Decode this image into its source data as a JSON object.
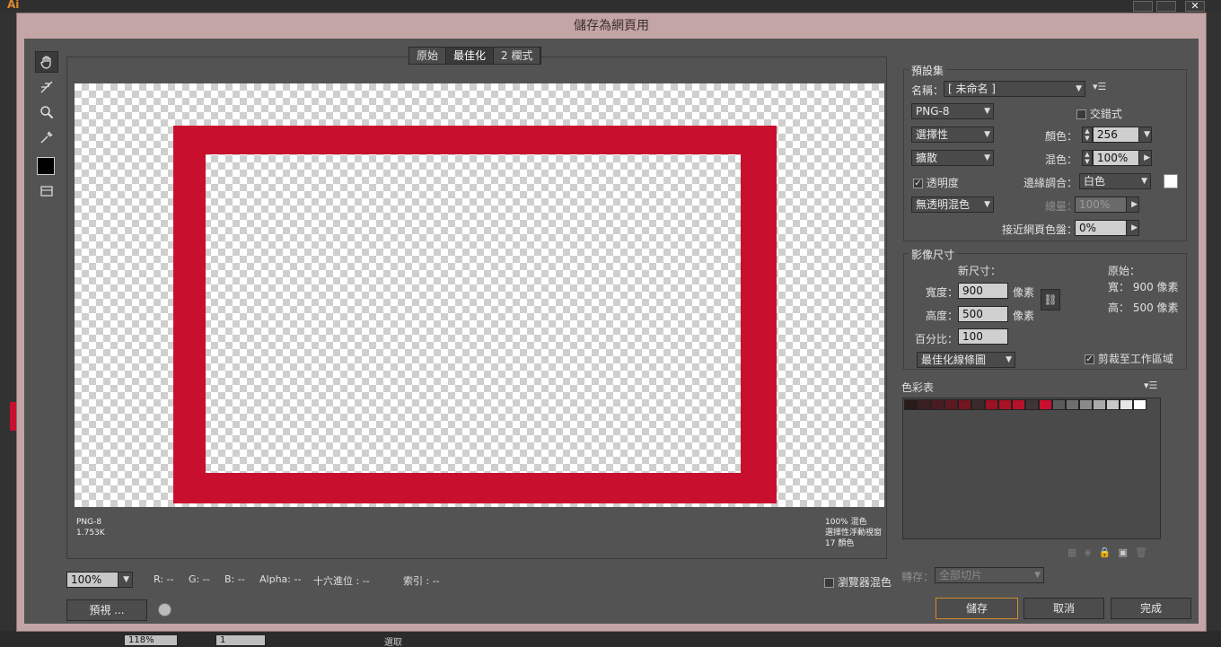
{
  "dialog": {
    "title": "儲存為網頁用"
  },
  "view_tabs": [
    {
      "label": "原始",
      "selected": false
    },
    {
      "label": "最佳化",
      "selected": true
    },
    {
      "label": "2 欄式",
      "selected": false
    }
  ],
  "preview": {
    "format": "PNG-8",
    "size": "1.753K",
    "info_right": [
      "100% 混色",
      "選擇性浮動視窗",
      "17 顏色"
    ]
  },
  "bottom_bar": {
    "zoom": "100%",
    "r": "R: --",
    "g": "G: --",
    "b": "B: --",
    "alpha": "Alpha: --",
    "hex": "十六進位 : --",
    "index": "索引 : --",
    "preview_button": "預視 ...",
    "browser_dither": "瀏覽器混色"
  },
  "preset": {
    "group_title": "預設集",
    "name_label": "名稱：",
    "name_value": "[ 未命名 ]",
    "format": "PNG-8",
    "interlaced_label": "交錯式",
    "reduction": "選擇性",
    "colors_label": "顏色：",
    "colors_value": "256",
    "dither_algo": "擴散",
    "dither_label": "混色：",
    "dither_value": "100%",
    "transparency_label": "透明度",
    "transparency_checked": true,
    "matte_label": "邊緣調合：",
    "matte_value": "白色",
    "trans_dither": "無透明混色",
    "amount_label": "總量：",
    "amount_value": "100%",
    "websnap_label": "接近網頁色盤：",
    "websnap_value": "0%"
  },
  "image_size": {
    "group_title": "影像尺寸",
    "new_size_label": "新尺寸：",
    "original_label": "原始：",
    "width_label": "寬度：",
    "width_value": "900",
    "height_label": "高度：",
    "height_value": "500",
    "unit": "像素",
    "orig_width": "寬： 900 像素",
    "orig_height": "高： 500 像素",
    "percent_label": "百分比：",
    "percent_value": "100",
    "quality": "最佳化線條圖",
    "clip_label": "剪裁至工作區域",
    "clip_checked": true
  },
  "color_table": {
    "title": "色彩表",
    "swatches": [
      "#2a1a1a",
      "#3d1f22",
      "#4a1c22",
      "#5e1820",
      "#741520",
      "#3a2a2a",
      "#9a1224",
      "#a81226",
      "#b5122a",
      "#3e3636",
      "#c8102e",
      "#5a5a5a",
      "#6e6e6e",
      "#8a8a8a",
      "#aaaaaa",
      "#c8c8c8",
      "#e6e6e6",
      "#ffffff"
    ]
  },
  "export": {
    "label": "轉存：",
    "value": "全部切片"
  },
  "buttons": {
    "save": "儲存",
    "cancel": "取消",
    "done": "完成"
  },
  "background_app": {
    "zoom": "118%",
    "page": "1",
    "status": "選取"
  }
}
